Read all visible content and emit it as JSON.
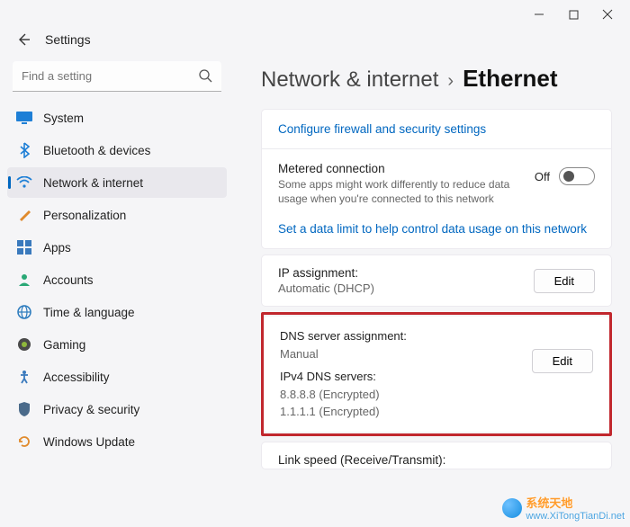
{
  "window": {
    "app_title": "Settings"
  },
  "search": {
    "placeholder": "Find a setting"
  },
  "sidebar": {
    "items": [
      {
        "label": "System"
      },
      {
        "label": "Bluetooth & devices"
      },
      {
        "label": "Network & internet"
      },
      {
        "label": "Personalization"
      },
      {
        "label": "Apps"
      },
      {
        "label": "Accounts"
      },
      {
        "label": "Time & language"
      },
      {
        "label": "Gaming"
      },
      {
        "label": "Accessibility"
      },
      {
        "label": "Privacy & security"
      },
      {
        "label": "Windows Update"
      }
    ],
    "selected_index": 2
  },
  "breadcrumb": {
    "parent": "Network & internet",
    "separator": "›",
    "current": "Ethernet"
  },
  "panel_top": {
    "link_firewall": "Configure firewall and security settings",
    "metered_title": "Metered connection",
    "metered_desc": "Some apps might work differently to reduce data usage when you're connected to this network",
    "toggle_state": "Off",
    "link_data_limit": "Set a data limit to help control data usage on this network"
  },
  "ip_panel": {
    "label": "IP assignment:",
    "value": "Automatic (DHCP)",
    "edit": "Edit"
  },
  "dns_panel": {
    "label1": "DNS server assignment:",
    "value1": "Manual",
    "label2": "IPv4 DNS servers:",
    "value2a": "8.8.8.8 (Encrypted)",
    "value2b": "1.1.1.1 (Encrypted)",
    "edit": "Edit"
  },
  "link_speed": {
    "label": "Link speed (Receive/Transmit):"
  },
  "watermark": {
    "text": "系统天地",
    "url": "www.XiTongTianDi.net"
  }
}
